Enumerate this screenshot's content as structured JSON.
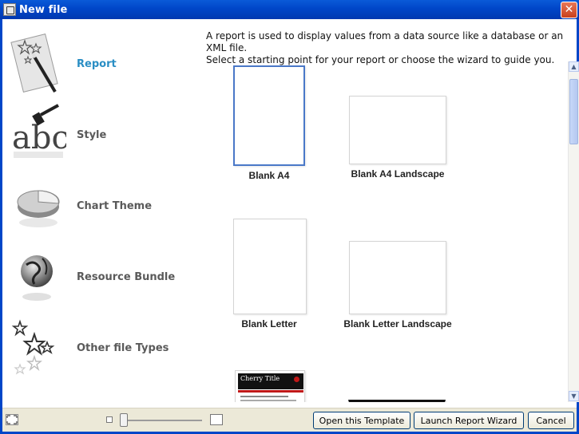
{
  "window": {
    "title": "New file",
    "close_glyph": "✕"
  },
  "categories": [
    {
      "label": "Report",
      "icon": "magic-wand-icon",
      "active": true
    },
    {
      "label": "Style",
      "icon": "abc-style-icon",
      "active": false
    },
    {
      "label": "Chart Theme",
      "icon": "pie-chart-icon",
      "active": false
    },
    {
      "label": "Resource Bundle",
      "icon": "globe-icon",
      "active": false
    },
    {
      "label": "Other file Types",
      "icon": "stars-icon",
      "active": false
    }
  ],
  "description": {
    "line1": "A report is used to display values from a data source like a database or an XML file.",
    "line2": "Select a starting point for your report or choose the wizard to guide you."
  },
  "templates": [
    {
      "label": "Blank A4",
      "selected": true
    },
    {
      "label": "Blank A4 Landscape",
      "selected": false
    },
    {
      "label": "Blank Letter",
      "selected": false
    },
    {
      "label": "Blank Letter Landscape",
      "selected": false
    },
    {
      "label": "",
      "preview_title": "Cherry Title",
      "selected": false
    }
  ],
  "scroll": {
    "up": "▲",
    "down": "▼"
  },
  "buttons": {
    "open_template": "Open this Template",
    "launch_wizard": "Launch Report Wizard",
    "cancel": "Cancel"
  },
  "colors": {
    "active_category": "#2a8ec4",
    "titlebar": "#0046c8",
    "selected_border": "#4a78c8"
  }
}
